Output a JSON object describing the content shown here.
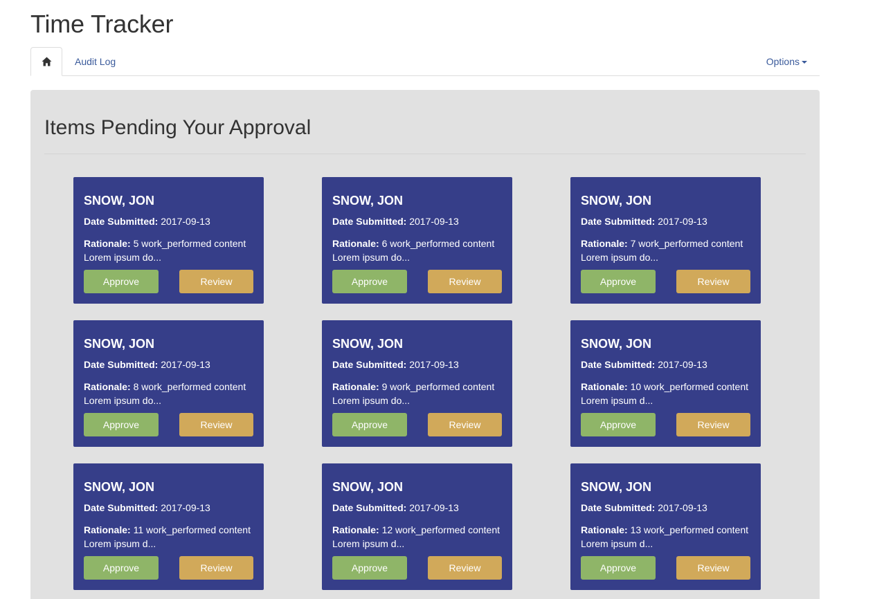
{
  "app": {
    "title": "Time Tracker"
  },
  "nav": {
    "home_icon": "home-icon",
    "audit_log": "Audit Log",
    "options": "Options"
  },
  "main": {
    "heading": "Items Pending Your Approval"
  },
  "labels": {
    "date_submitted": "Date Submitted:",
    "rationale": "Rationale:",
    "approve": "Approve",
    "review": "Review"
  },
  "colors": {
    "card_bg": "#363e89",
    "approve_btn": "#8fb568",
    "review_btn": "#d1a95a",
    "panel_bg": "#e1e1e1",
    "link": "#3a5a9b"
  },
  "cards": [
    {
      "name": "SNOW, JON",
      "date": "2017-09-13",
      "rationale": "5 work_performed content Lorem ipsum do..."
    },
    {
      "name": "SNOW, JON",
      "date": "2017-09-13",
      "rationale": "6 work_performed content Lorem ipsum do..."
    },
    {
      "name": "SNOW, JON",
      "date": "2017-09-13",
      "rationale": "7 work_performed content Lorem ipsum do..."
    },
    {
      "name": "SNOW, JON",
      "date": "2017-09-13",
      "rationale": "8 work_performed content Lorem ipsum do..."
    },
    {
      "name": "SNOW, JON",
      "date": "2017-09-13",
      "rationale": "9 work_performed content Lorem ipsum do..."
    },
    {
      "name": "SNOW, JON",
      "date": "2017-09-13",
      "rationale": "10 work_performed content Lorem ipsum d..."
    },
    {
      "name": "SNOW, JON",
      "date": "2017-09-13",
      "rationale": "11 work_performed content Lorem ipsum d..."
    },
    {
      "name": "SNOW, JON",
      "date": "2017-09-13",
      "rationale": "12 work_performed content Lorem ipsum d..."
    },
    {
      "name": "SNOW, JON",
      "date": "2017-09-13",
      "rationale": "13 work_performed content Lorem ipsum d..."
    }
  ]
}
